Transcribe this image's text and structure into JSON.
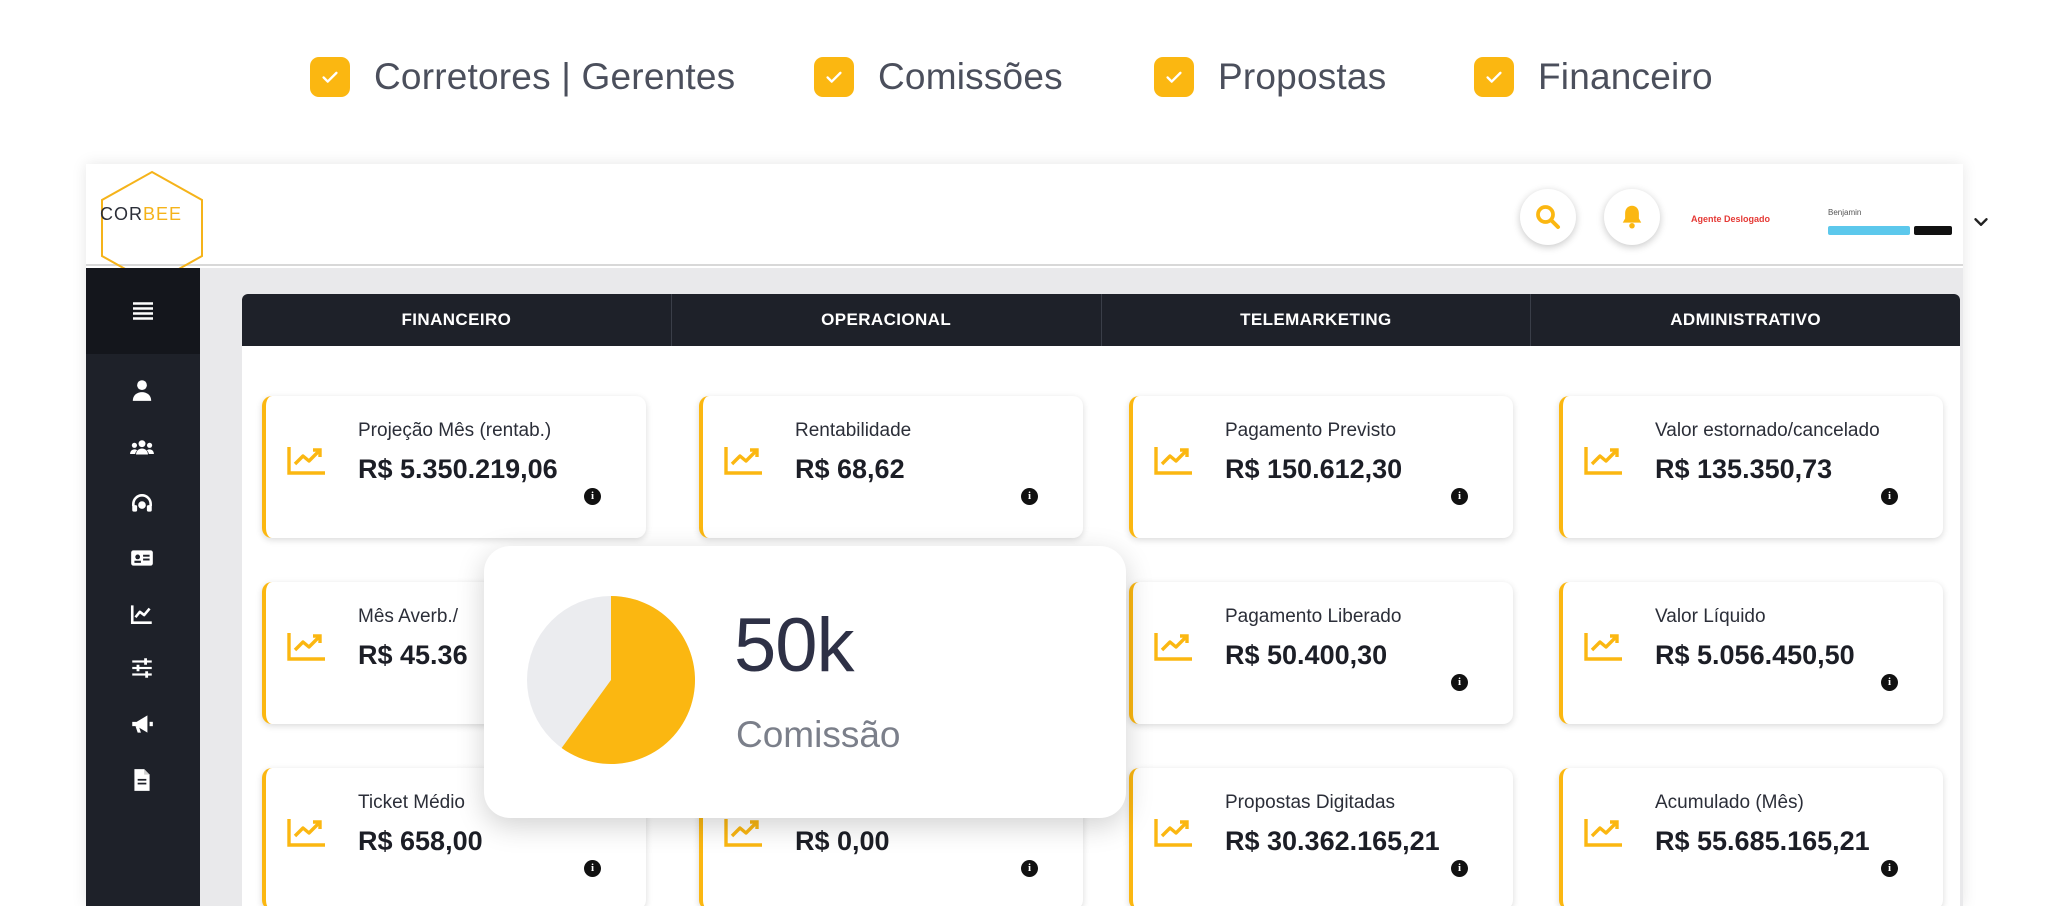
{
  "features": [
    {
      "label": "Corretores | Gerentes",
      "checked": true
    },
    {
      "label": "Comissões",
      "checked": true
    },
    {
      "label": "Propostas",
      "checked": true
    },
    {
      "label": "Financeiro",
      "checked": true
    }
  ],
  "header": {
    "logo": {
      "part1": "COR",
      "part2": "BEE"
    },
    "search_icon": "search-icon",
    "notification_icon": "bell-icon",
    "agent_status": "Agente Deslogado",
    "user": {
      "name": "Benjamin",
      "badge1": "",
      "badge2": ""
    }
  },
  "sidebar": {
    "items": [
      "menu-icon",
      "user-icon",
      "users-group-icon",
      "headset-icon",
      "id-card-icon",
      "chart-icon",
      "sliders-icon",
      "megaphone-icon",
      "document-icon"
    ]
  },
  "tabs": [
    "FINANCEIRO",
    "OPERACIONAL",
    "TELEMARKETING",
    "ADMINISTRATIVO"
  ],
  "cards": [
    {
      "title": "Projeção Mês (rentab.)",
      "value": "R$ 5.350.219,06"
    },
    {
      "title": "Rentabilidade",
      "value": "R$ 68,62"
    },
    {
      "title": "Pagamento Previsto",
      "value": "R$ 150.612,30"
    },
    {
      "title": "Valor estornado/cancelado",
      "value": "R$ 135.350,73"
    },
    {
      "title": "Mês Averb./",
      "value": "R$ 45.36"
    },
    {
      "title": "Pagamento Liberado",
      "value": "R$ 50.400,30"
    },
    {
      "title": "Valor Líquido",
      "value": "R$ 5.056.450,50"
    },
    {
      "title": "Ticket Médio",
      "value": "R$ 658,00"
    },
    {
      "title": "",
      "value": "R$ 0,00"
    },
    {
      "title": "Propostas Digitadas",
      "value": "R$ 30.362.165,21"
    },
    {
      "title": "Acumulado (Mês)",
      "value": "R$ 55.685.165,21"
    }
  ],
  "commission_widget": {
    "value": "50k",
    "label": "Comissão",
    "pie_fraction": 0.6
  },
  "colors": {
    "accent": "#fbb711",
    "dark": "#1e2129",
    "alert": "#e53935"
  }
}
